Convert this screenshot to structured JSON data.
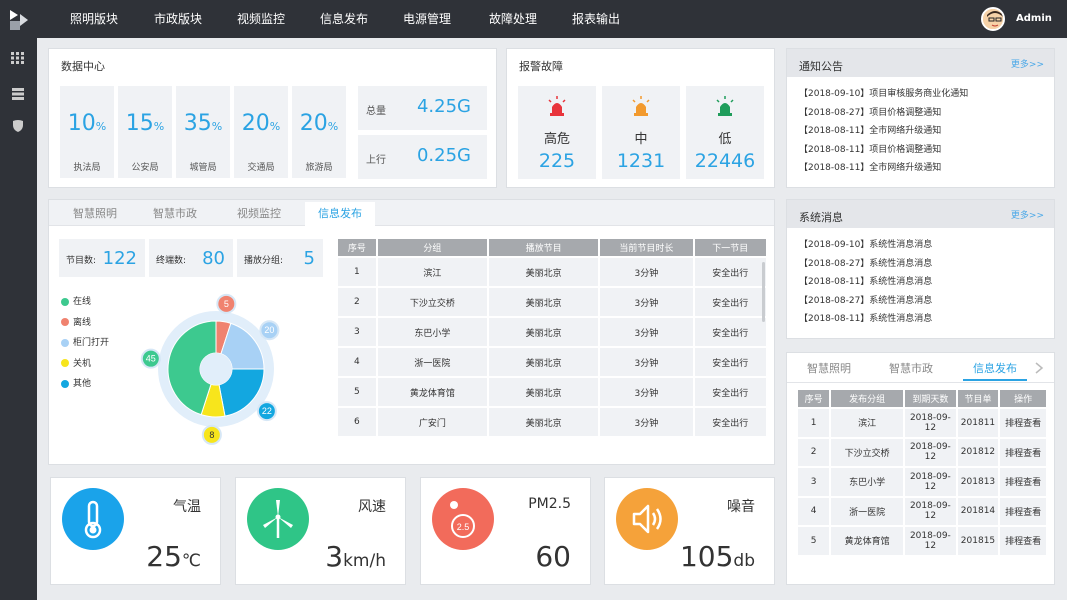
{
  "header": {
    "nav": [
      "照明版块",
      "市政版块",
      "视频监控",
      "信息发布",
      "电源管理",
      "故障处理",
      "报表输出"
    ],
    "user": "Admin"
  },
  "data_center": {
    "title": "数据中心",
    "stats": [
      {
        "value": "10",
        "unit": "%",
        "label": "执法局"
      },
      {
        "value": "15",
        "unit": "%",
        "label": "公安局"
      },
      {
        "value": "35",
        "unit": "%",
        "label": "城管局"
      },
      {
        "value": "20",
        "unit": "%",
        "label": "交通局"
      },
      {
        "value": "20",
        "unit": "%",
        "label": "旅游局"
      }
    ],
    "totals": [
      {
        "label": "总量",
        "value": "4.25G"
      },
      {
        "label": "上行",
        "value": "0.25G"
      }
    ]
  },
  "alarm": {
    "title": "报警故障",
    "levels": [
      {
        "label": "高危",
        "value": "225",
        "color": "#e8343b"
      },
      {
        "label": "中",
        "value": "1231",
        "color": "#f29a2e"
      },
      {
        "label": "低",
        "value": "22446",
        "color": "#1f9d5b"
      }
    ]
  },
  "notice": {
    "title": "通知公告",
    "more": "更多>>",
    "items": [
      "【2018-09-10】项目审核服务商业化通知",
      "【2018-08-27】项目价格调整通知",
      "【2018-08-11】全市网络升级通知",
      "【2018-08-11】项目价格调整通知",
      "【2018-08-11】全市网络升级通知"
    ]
  },
  "system_msg": {
    "title": "系统消息",
    "more": "更多>>",
    "items": [
      "【2018-09-10】系统性消息消息",
      "【2018-08-27】系统性消息消息",
      "【2018-08-11】系统性消息消息",
      "【2018-08-27】系统性消息消息",
      "【2018-08-11】系统性消息消息"
    ]
  },
  "info_panel": {
    "tabs": [
      "智慧照明",
      "智慧市政",
      "视频监控",
      "信息发布"
    ],
    "active_tab": 3,
    "kpis": [
      {
        "label": "节目数:",
        "value": "122"
      },
      {
        "label": "终端数:",
        "value": "80"
      },
      {
        "label": "播放分组:",
        "value": "5"
      }
    ],
    "legend": [
      {
        "label": "在线",
        "color": "#3dc98f"
      },
      {
        "label": "离线",
        "color": "#f0826f"
      },
      {
        "label": "柜门打开",
        "color": "#a8d1f5"
      },
      {
        "label": "关机",
        "color": "#f7e51c"
      },
      {
        "label": "其他",
        "color": "#13a7e0"
      }
    ],
    "table": {
      "headers": [
        "序号",
        "分组",
        "播放节目",
        "当前节目时长",
        "下一节目"
      ],
      "rows": [
        [
          "1",
          "滨江",
          "美丽北京",
          "3分钟",
          "安全出行"
        ],
        [
          "2",
          "下沙立交桥",
          "美丽北京",
          "3分钟",
          "安全出行"
        ],
        [
          "3",
          "东巴小学",
          "美丽北京",
          "3分钟",
          "安全出行"
        ],
        [
          "4",
          "浙一医院",
          "美丽北京",
          "3分钟",
          "安全出行"
        ],
        [
          "5",
          "黄龙体育馆",
          "美丽北京",
          "3分钟",
          "安全出行"
        ],
        [
          "6",
          "广安门",
          "美丽北京",
          "3分钟",
          "安全出行"
        ]
      ]
    }
  },
  "chart_data": {
    "type": "pie",
    "categories": [
      "在线",
      "离线",
      "柜门打开",
      "关机",
      "其他"
    ],
    "values": [
      45,
      5,
      20,
      8,
      22
    ],
    "colors": [
      "#3dc98f",
      "#f0826f",
      "#a8d1f5",
      "#f7e51c",
      "#13a7e0"
    ]
  },
  "right_panel": {
    "tabs": [
      "智慧照明",
      "智慧市政",
      "信息发布"
    ],
    "active_tab": 2,
    "table": {
      "headers": [
        "序号",
        "发布分组",
        "到期天数",
        "节目单",
        "操作"
      ],
      "rows": [
        [
          "1",
          "滨江",
          "2018-09-12",
          "201811",
          "排程查看"
        ],
        [
          "2",
          "下沙立交桥",
          "2018-09-12",
          "201812",
          "排程查看"
        ],
        [
          "3",
          "东巴小学",
          "2018-09-12",
          "201813",
          "排程查看"
        ],
        [
          "4",
          "浙一医院",
          "2018-09-12",
          "201814",
          "排程查看"
        ],
        [
          "5",
          "黄龙体育馆",
          "2018-09-12",
          "201815",
          "排程查看"
        ]
      ]
    }
  },
  "weather": [
    {
      "label": "气温",
      "value": "25",
      "unit": "℃",
      "color": "#1aa3ea",
      "icon": "thermometer-icon"
    },
    {
      "label": "风速",
      "value": "3",
      "unit": "km/h",
      "color": "#2fc587",
      "icon": "wind-turbine-icon"
    },
    {
      "label": "PM2.5",
      "value": "60",
      "unit": "",
      "color": "#f26b5b",
      "icon": "pm25-icon",
      "badge": "2.5"
    },
    {
      "label": "噪音",
      "value": "105",
      "unit": "db",
      "color": "#f5a23a",
      "icon": "speaker-icon"
    }
  ]
}
